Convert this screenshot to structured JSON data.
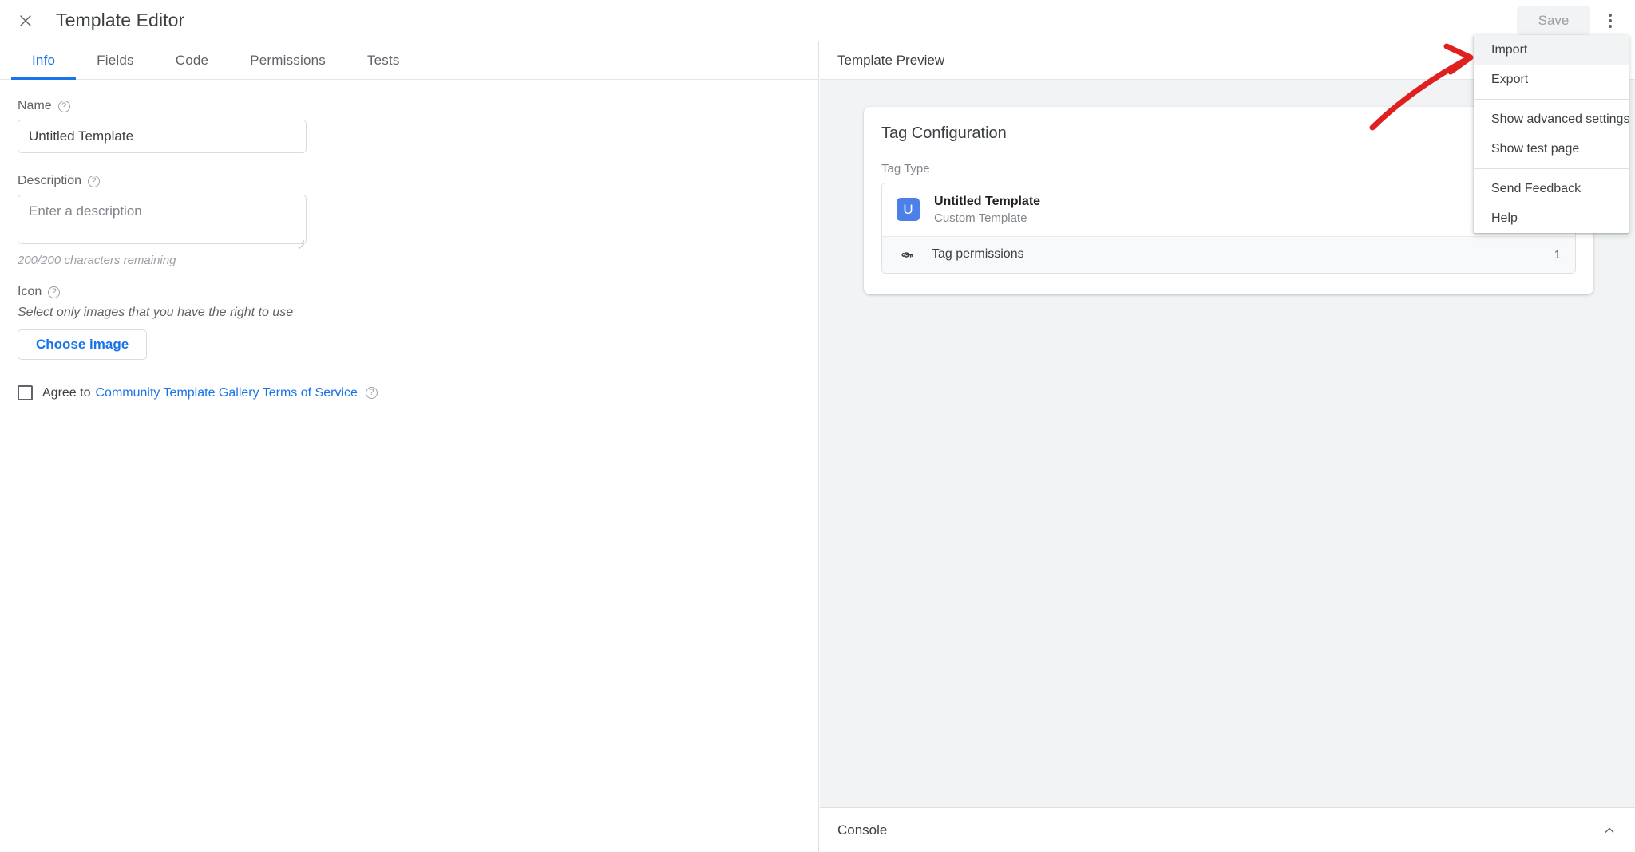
{
  "topbar": {
    "close_icon": "close-icon",
    "title": "Template Editor",
    "save_label": "Save",
    "overflow_icon": "more-vert-icon"
  },
  "tabs": [
    {
      "label": "Info",
      "active": true
    },
    {
      "label": "Fields",
      "active": false
    },
    {
      "label": "Code",
      "active": false
    },
    {
      "label": "Permissions",
      "active": false
    },
    {
      "label": "Tests",
      "active": false
    }
  ],
  "form": {
    "name_label": "Name",
    "name_value": "Untitled Template",
    "description_label": "Description",
    "description_placeholder": "Enter a description",
    "description_value": "",
    "char_count": "200/200 characters remaining",
    "icon_label": "Icon",
    "icon_hint": "Select only images that you have the right to use",
    "choose_image_label": "Choose image",
    "agree_prefix": "Agree to",
    "agree_link": "Community Template Gallery Terms of Service",
    "agree_checked": false,
    "help_icon": "help-circle-icon"
  },
  "preview": {
    "header": "Template Preview",
    "card_title": "Tag Configuration",
    "tag_type_label": "Tag Type",
    "tag_name": "Untitled Template",
    "tag_subtitle": "Custom Template",
    "tag_avatar_letter": "U",
    "permissions_label": "Tag permissions",
    "permissions_count": "1",
    "permissions_icon": "key-icon"
  },
  "console": {
    "title": "Console",
    "toggle_icon": "chevron-up-icon"
  },
  "menu": {
    "items": [
      {
        "label": "Import",
        "hover": true,
        "separator_after": false
      },
      {
        "label": "Export",
        "hover": false,
        "separator_after": true
      },
      {
        "label": "Show advanced settings",
        "hover": false,
        "separator_after": false
      },
      {
        "label": "Show test page",
        "hover": false,
        "separator_after": true
      },
      {
        "label": "Send Feedback",
        "hover": false,
        "separator_after": false
      },
      {
        "label": "Help",
        "hover": false,
        "separator_after": false
      }
    ]
  },
  "annotation": {
    "type": "curved-arrow",
    "color": "#e02020",
    "points_to": "Import"
  },
  "colors": {
    "accent": "#1a73e8",
    "avatar": "#4d7fe8",
    "panel_bg": "#f1f3f4",
    "annotation": "#e02020"
  }
}
